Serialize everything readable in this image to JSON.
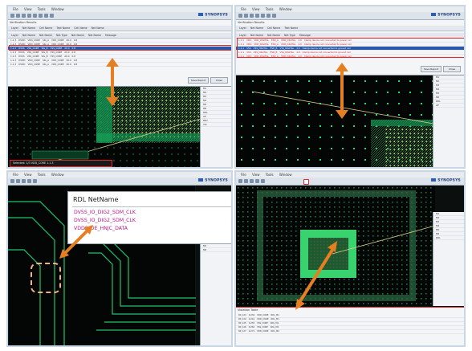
{
  "app": {
    "logo_text": "SYNOPSYS",
    "menu": [
      "File",
      "View",
      "Tools",
      "Window"
    ]
  },
  "top_left": {
    "panel_title": "Verification Results",
    "filter_tabs": [
      "Layer",
      "Net Name",
      "Cell Name",
      "Text Name",
      "Cell Name",
      "Net Name"
    ],
    "columns": [
      "Layer",
      "Net Name",
      "Net Name",
      "Net Type",
      "Net Name",
      "Net Name",
      "Message"
    ],
    "rows": [
      [
        "1.1.3",
        "DVDD",
        "VDD_CORE",
        "SIG_A",
        "VDD_CORE",
        "20.0",
        "0.8"
      ],
      [
        "1.1.3",
        "DVDD",
        "VDD_CORE",
        "SIG_A",
        "VDD_CORE",
        "20.0",
        "0.8"
      ],
      [
        "1.1.3",
        "DVSS",
        "VSS_CORE",
        "SIG_B",
        "VSS_CORE",
        "20.0",
        "0.8"
      ],
      [
        "1.1.3",
        "DVSS",
        "VSS_CORE",
        "SIG_B",
        "VSS_CORE",
        "20.0",
        "0.8"
      ],
      [
        "1.1.3",
        "DVSS",
        "VSS_CORE",
        "SIG_B",
        "VSS_CORE",
        "20.0",
        "0.8"
      ],
      [
        "1.1.3",
        "DVDD",
        "VDD_CORE",
        "SIG_A",
        "VDD_CORE",
        "20.0",
        "0.8"
      ],
      [
        "1.1.3",
        "DVDD",
        "VDD_CORE",
        "SIG_A",
        "VDD_CORE",
        "20.0",
        "0.8"
      ]
    ],
    "save_button": "Save Report",
    "close_button": "Close",
    "status_text": "Selected: 1/3   VDD_CORE   1.1.3"
  },
  "top_right": {
    "panel_title": "Verification Results",
    "rows": [
      [
        "1.1.1",
        "VDD",
        "VDD_DIGITAL",
        "ESD_A",
        "VDD_DIGITAL",
        "4.0",
        "Clamp device not connected to power rail"
      ],
      [
        "1.1.1",
        "VDD",
        "VDD_DIGITAL",
        "ESD_A",
        "VDD_DIGITAL",
        "4.0",
        "Clamp device not connected to power rail"
      ],
      [
        "1.1.1",
        "VSS",
        "VSS_DIGITAL",
        "ESD_B",
        "VSS_DIGITAL",
        "4.0",
        "Clamp device not connected to ground rail"
      ],
      [
        "1.1.1",
        "VSS",
        "VSS_DIGITAL",
        "ESD_B",
        "VSS_DIGITAL",
        "4.0",
        "Clamp device not connected to ground rail"
      ],
      [
        "1.1.1",
        "VDD",
        "VDD_DIGITAL",
        "ESD_A",
        "VDD_DIGITAL",
        "4.0",
        "Clamp device not connected to power rail"
      ]
    ],
    "save_button": "Save Report",
    "close_button": "Close"
  },
  "bottom_left": {
    "popup_title": "RDL NetName",
    "nets": [
      "DVSS_IO_DIG2_SDM_CLK",
      "DVSS_IO_DIG2_SDM_CLK",
      "VDD0_DE_HNJC_DATA"
    ]
  },
  "bottom_right": {
    "panel_title": "Violation Table",
    "rows": [
      [
        "R0_123",
        "0.234",
        "VDD_CORE",
        "RDL_M1"
      ],
      [
        "R0_124",
        "0.241",
        "VDD_CORE",
        "RDL_M1"
      ],
      [
        "R0_125",
        "0.255",
        "VSS_CORE",
        "RDL_M1"
      ],
      [
        "R0_126",
        "0.262",
        "VSS_CORE",
        "RDL_M2"
      ],
      [
        "R0_127",
        "0.271",
        "VDD_CORE",
        "RDL_M2"
      ]
    ]
  },
  "side_panel": {
    "layers": [
      "M1",
      "M2",
      "M3",
      "M4",
      "M5",
      "M6",
      "RDL",
      "AP",
      "PAD",
      "VIA"
    ]
  },
  "colors": {
    "highlight": "#e02b2b",
    "arrow": "#e67e22",
    "net_text": "#b5178a",
    "selection": "#2a58a6"
  }
}
